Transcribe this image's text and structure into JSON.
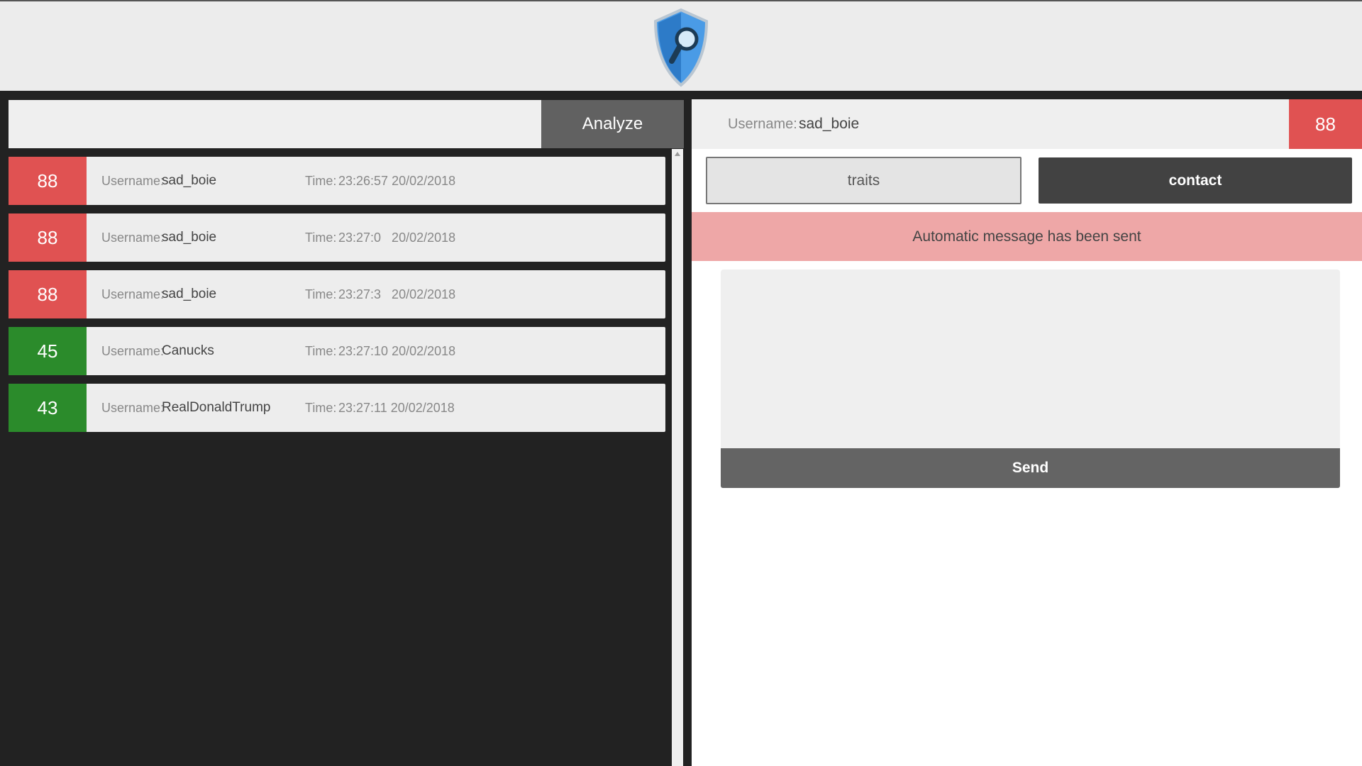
{
  "header": {
    "logo_icon": "shield-search-icon"
  },
  "search": {
    "value": "",
    "placeholder": "",
    "analyze_label": "Analyze"
  },
  "labels": {
    "username": "Username:",
    "time": "Time:"
  },
  "results": [
    {
      "score": "88",
      "status": "red",
      "username": "sad_boie",
      "time": "23:26:57 20/02/2018"
    },
    {
      "score": "88",
      "status": "red",
      "username": "sad_boie",
      "time": "23:27:0   20/02/2018"
    },
    {
      "score": "88",
      "status": "red",
      "username": "sad_boie",
      "time": "23:27:3   20/02/2018"
    },
    {
      "score": "45",
      "status": "green",
      "username": "Canucks",
      "time": "23:27:10 20/02/2018"
    },
    {
      "score": "43",
      "status": "green",
      "username": "RealDonaldTrump",
      "time": "23:27:11 20/02/2018"
    }
  ],
  "detail": {
    "username_label": "Username:",
    "username": "sad_boie",
    "score": "88",
    "tabs": {
      "traits": "traits",
      "contact": "contact"
    },
    "alert": "Automatic message has been sent",
    "message_value": "",
    "send_label": "Send"
  },
  "colors": {
    "danger": "#e05252",
    "safe": "#2b8b2b",
    "alert_bg": "#eea7a7",
    "dark_bg": "#222222",
    "accent": "#3d8fe0"
  }
}
